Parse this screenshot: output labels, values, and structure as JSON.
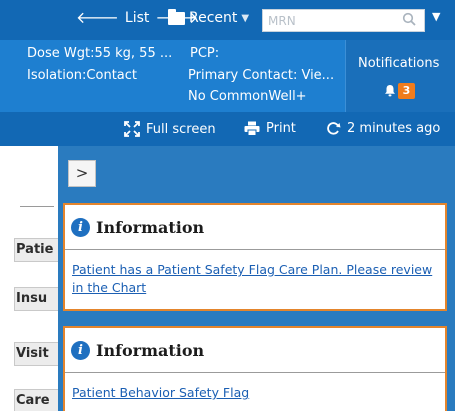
{
  "toolbar": {
    "list_label": "List",
    "recent_label": "Recent",
    "mrn_placeholder": "MRN"
  },
  "banner": {
    "dose_weight": "Dose Wgt:55 kg, 55 ...",
    "isolation": "Isolation:Contact",
    "pcp": "PCP:",
    "primary_contact": "Primary Contact: Vie...",
    "commonwell": "No CommonWell+",
    "notifications_label": "Notifications",
    "notifications_count": "3"
  },
  "actions": {
    "full_screen": "Full screen",
    "print": "Print",
    "refreshed": "2 minutes ago"
  },
  "side_tabs": [
    "Patie",
    "Insu",
    "Visit",
    "Care"
  ],
  "panel": {
    "collapse_symbol": ">",
    "cards": [
      {
        "title": "Information",
        "link": "Patient has a Patient Safety Flag Care Plan. Please review in the Chart"
      },
      {
        "title": "Information",
        "link": "Patient Behavior Safety Flag"
      }
    ]
  },
  "colors": {
    "toolbar_blue": "#1268b4",
    "banner_blue": "#1e7fd0",
    "panel_blue": "#2a7bbf",
    "alert_orange": "#e4852c",
    "badge_orange": "#f07c1c",
    "link_blue": "#1b5fb3"
  }
}
